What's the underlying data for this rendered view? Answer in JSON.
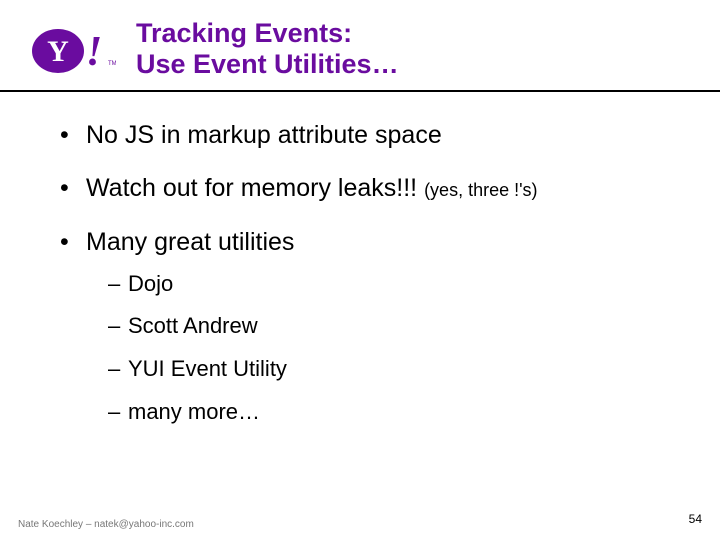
{
  "header": {
    "title_line1": "Tracking Events:",
    "title_line2": "Use Event Utilities…"
  },
  "bullets": {
    "b1": "No JS in markup attribute space",
    "b2_main": "Watch out for memory leaks!!! ",
    "b2_note": "(yes, three !'s)",
    "b3": "Many great utilities",
    "subs": {
      "s1": "Dojo",
      "s2": "Scott Andrew",
      "s3": "YUI Event Utility",
      "s4": "many more…"
    }
  },
  "footer": {
    "author": "Nate Koechley – natek@yahoo-inc.com",
    "page": "54"
  },
  "logo": {
    "letter": "Y",
    "bang": "!",
    "tm": "TM"
  }
}
